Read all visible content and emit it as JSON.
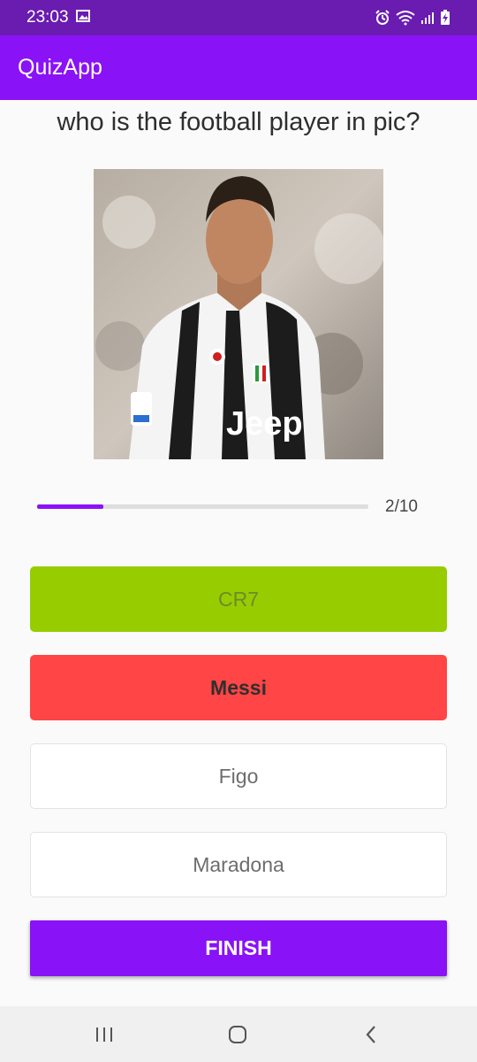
{
  "status_bar": {
    "time": "23:03",
    "icons": [
      "gallery-icon",
      "alarm-icon",
      "wifi-icon",
      "signal-icon",
      "battery-charging-icon"
    ]
  },
  "app_bar": {
    "title": "QuizApp"
  },
  "quiz": {
    "question": "who is the football player in pic?",
    "image_subject": "football player photo",
    "progress": {
      "current": 2,
      "total": 10,
      "label": "2/10",
      "fill_fraction": 0.2
    },
    "options": [
      {
        "label": "CR7",
        "state": "correct"
      },
      {
        "label": "Messi",
        "state": "wrong-selected"
      },
      {
        "label": "Figo",
        "state": "default"
      },
      {
        "label": "Maradona",
        "state": "default"
      }
    ],
    "finish_label": "FINISH"
  },
  "nav_bar": {
    "icons": [
      "recent-apps-icon",
      "home-icon",
      "back-icon"
    ]
  },
  "colors": {
    "status_bar": "#6a1bb0",
    "primary": "#8a12f6",
    "correct": "#97cd00",
    "wrong": "#ff4545"
  }
}
